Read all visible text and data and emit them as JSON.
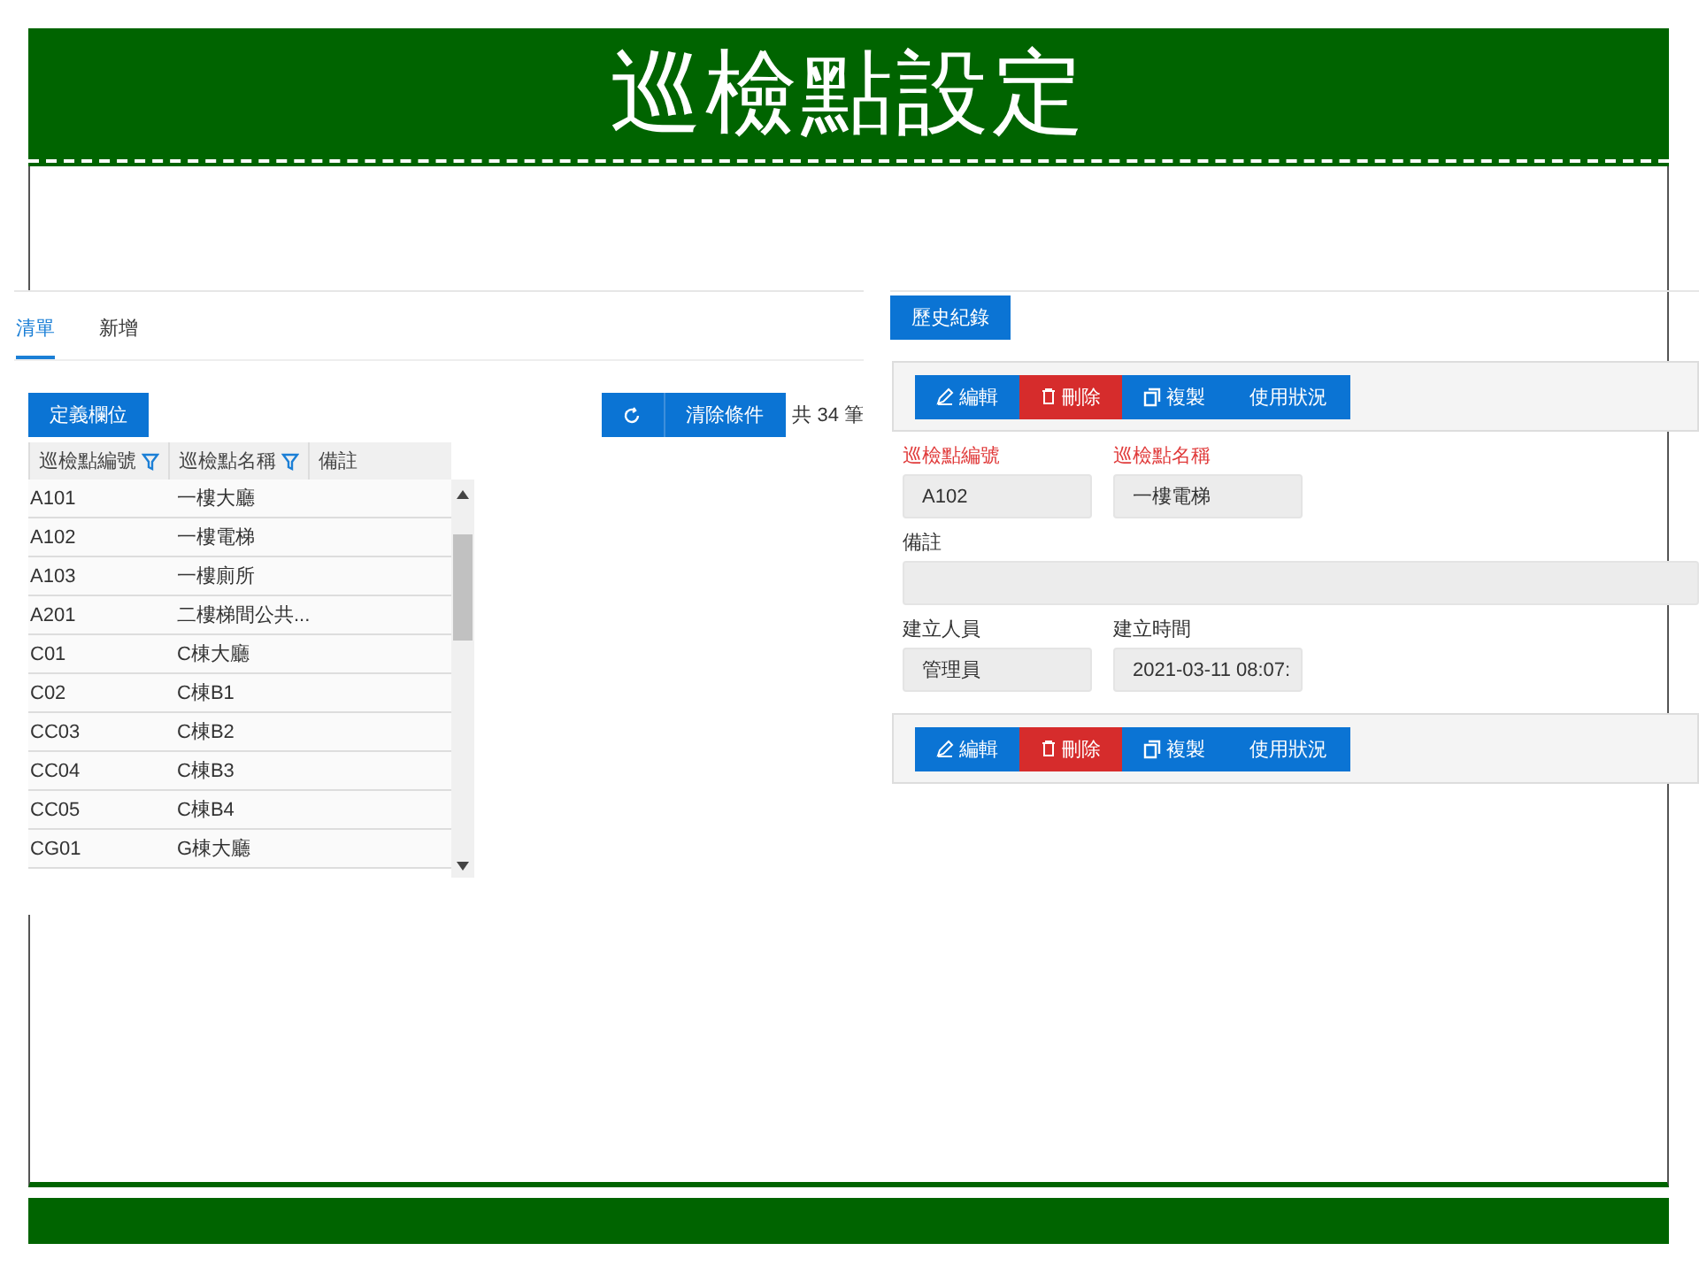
{
  "slide": {
    "title": "巡檢點設定"
  },
  "list_panel": {
    "tabs": [
      {
        "label": "清單",
        "selected": true
      },
      {
        "label": "新增",
        "selected": false
      }
    ],
    "define_columns_button": "定義欄位",
    "clear_filter_button": "清除條件",
    "total": "共 34 筆",
    "table": {
      "columns": [
        {
          "label": "巡檢點編號",
          "filterable": true
        },
        {
          "label": "巡檢點名稱",
          "filterable": true
        },
        {
          "label": "備註",
          "filterable": false
        }
      ],
      "rows": [
        [
          "A101",
          "一樓大廳",
          ""
        ],
        [
          "A102",
          "一樓電梯",
          ""
        ],
        [
          "A103",
          "一樓廁所",
          ""
        ],
        [
          "A201",
          "二樓梯間公共...",
          ""
        ],
        [
          "C01",
          "C棟大廳",
          ""
        ],
        [
          "C02",
          "C棟B1",
          ""
        ],
        [
          "CC03",
          "C棟B2",
          ""
        ],
        [
          "CC04",
          "C棟B3",
          ""
        ],
        [
          "CC05",
          "C棟B4",
          ""
        ],
        [
          "CG01",
          "G棟大廳",
          ""
        ]
      ]
    }
  },
  "detail_panel": {
    "history_button": "歷史紀錄",
    "action_bars": [
      {
        "buttons": [
          {
            "kind": "edit",
            "label": "編輯"
          },
          {
            "kind": "delete",
            "label": "刪除"
          },
          {
            "kind": "copy",
            "label": "複製"
          },
          {
            "kind": "usage",
            "label": "使用狀況"
          }
        ]
      },
      {
        "buttons": [
          {
            "kind": "edit",
            "label": "編輯"
          },
          {
            "kind": "delete",
            "label": "刪除"
          },
          {
            "kind": "copy",
            "label": "複製"
          },
          {
            "kind": "usage",
            "label": "使用狀況"
          }
        ]
      }
    ],
    "field_rows": [
      [
        {
          "label": "巡檢點編號",
          "value": "A102",
          "required": true
        },
        {
          "label": "巡檢點名稱",
          "value": "一樓電梯",
          "required": true
        }
      ],
      [
        {
          "label": "備註",
          "required": false
        }
      ],
      [
        {
          "label": "建立人員",
          "value": "管理員",
          "required": false
        },
        {
          "label": "建立時間",
          "value": "2021-03-11 08:07:",
          "required": false
        }
      ]
    ]
  }
}
